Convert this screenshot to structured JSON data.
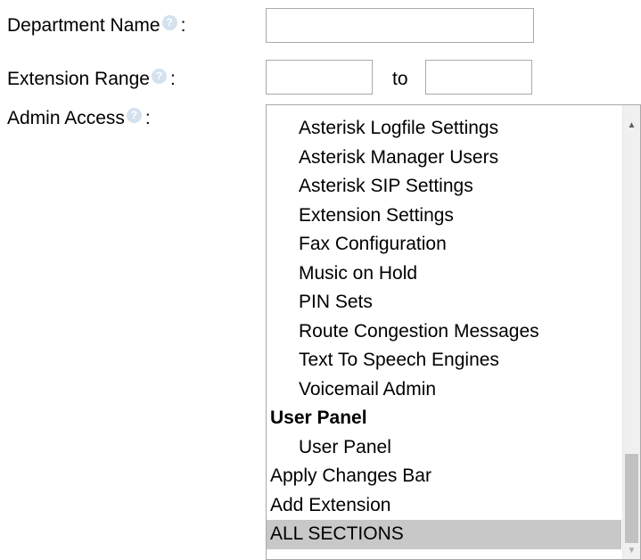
{
  "form": {
    "department_label": "Department Name",
    "extension_range_label": "Extension Range",
    "admin_access_label": "Admin Access",
    "colon": ":",
    "help_glyph": "?",
    "department_value": "",
    "range_from_value": "",
    "range_to_value": "",
    "to_label": "to"
  },
  "admin_access_list": {
    "items": [
      {
        "label": "Asterisk Logfile Settings",
        "kind": "option",
        "indent": true,
        "selected": false
      },
      {
        "label": "Asterisk Manager Users",
        "kind": "option",
        "indent": true,
        "selected": false
      },
      {
        "label": "Asterisk SIP Settings",
        "kind": "option",
        "indent": true,
        "selected": false
      },
      {
        "label": "Extension Settings",
        "kind": "option",
        "indent": true,
        "selected": false
      },
      {
        "label": "Fax Configuration",
        "kind": "option",
        "indent": true,
        "selected": false
      },
      {
        "label": "Music on Hold",
        "kind": "option",
        "indent": true,
        "selected": false
      },
      {
        "label": "PIN Sets",
        "kind": "option",
        "indent": true,
        "selected": false
      },
      {
        "label": "Route Congestion Messages",
        "kind": "option",
        "indent": true,
        "selected": false
      },
      {
        "label": "Text To Speech Engines",
        "kind": "option",
        "indent": true,
        "selected": false
      },
      {
        "label": "Voicemail Admin",
        "kind": "option",
        "indent": true,
        "selected": false
      },
      {
        "label": "User Panel",
        "kind": "group",
        "indent": false,
        "selected": false
      },
      {
        "label": "User Panel",
        "kind": "option",
        "indent": true,
        "selected": false
      },
      {
        "label": "Apply Changes Bar",
        "kind": "option",
        "indent": false,
        "selected": false
      },
      {
        "label": "Add Extension",
        "kind": "option",
        "indent": false,
        "selected": false
      },
      {
        "label": "ALL SECTIONS",
        "kind": "option",
        "indent": false,
        "selected": true
      }
    ]
  },
  "colors": {
    "help_icon": "#d4e1ef",
    "selected_option_bg": "#c8c8c8",
    "input_border": "#a9a9a9"
  },
  "icons": {
    "help": "help-icon",
    "scroll_up": "chevron-up-icon",
    "scroll_down": "chevron-down-icon"
  }
}
